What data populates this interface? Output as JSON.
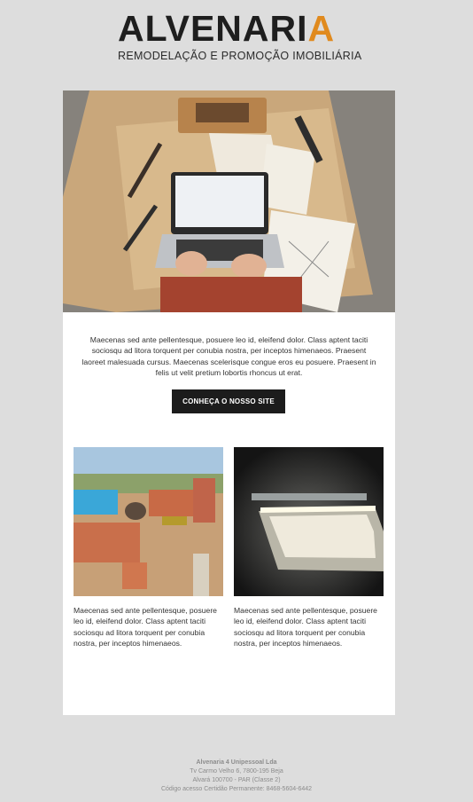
{
  "header": {
    "logo_text": "ALVENARI",
    "logo_accent": "A",
    "tagline": "REMODELAÇÃO E PROMOÇÃO IMOBILIÁRIA"
  },
  "colors": {
    "accent": "#e08a1e",
    "dark": "#1c1c1c",
    "page_bg": "#dddddd",
    "card_bg": "#ffffff"
  },
  "hero": {
    "image": "workbench-laptop-photo"
  },
  "intro": {
    "text": "Maecenas sed ante pellentesque, posuere leo id, eleifend dolor. Class aptent taciti sociosqu ad litora torquent per conubia nostra, per inceptos himenaeos. Praesent laoreet malesuada cursus. Maecenas scelerisque congue eros eu posuere. Praesent in felis ut velit pretium lobortis rhoncus ut erat."
  },
  "cta": {
    "label": "CONHEÇA O NOSSO SITE"
  },
  "columns": [
    {
      "image": "brick-construction-photo",
      "text": "Maecenas sed ante pellentesque, posuere leo id, eleifend dolor. Class aptent taciti sociosqu ad litora torquent per conubia nostra, per inceptos himenaeos."
    },
    {
      "image": "lit-pool-night-photo",
      "text": "Maecenas sed ante pellentesque, posuere leo id, eleifend dolor. Class aptent taciti sociosqu ad litora torquent per conubia nostra, per inceptos himenaeos."
    }
  ],
  "footer": {
    "company": "Alvenaria 4 Unipessoal Lda",
    "address": "Tv Carmo Velho 6, 7800-195 Beja",
    "license": "Alvará 100700 - PAR (Classe 2)",
    "certificate": "Código acesso Certidão Permanente: 8468-5604-6442"
  }
}
